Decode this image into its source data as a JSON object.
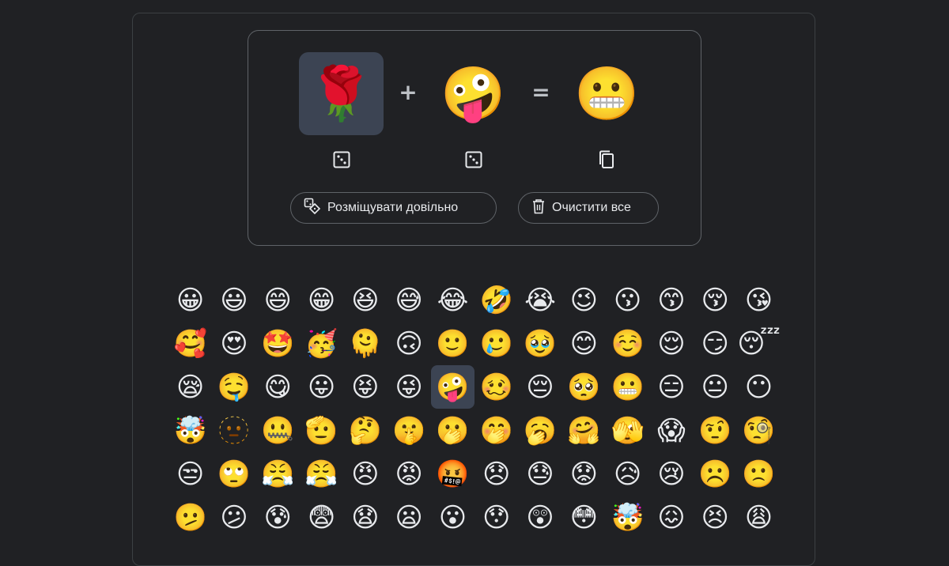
{
  "mixer": {
    "left_emoji": "🌹",
    "left_icon_name": "rose",
    "plus_sign": "+",
    "right_emoji": "🤪",
    "right_icon_name": "zany-face",
    "equals_sign": "=",
    "result_emoji": "😬",
    "result_icon_name": "grimacing-face-with-rose",
    "left_action_icon": "dice-icon",
    "right_action_icon": "dice-icon",
    "result_action_icon": "copy-icon"
  },
  "actions": {
    "randomize_label": "Розміщувати довільно",
    "clear_label": "Очистити все"
  },
  "colors": {
    "background": "#202124",
    "selected_slot": "#3c4453",
    "border": "#5f6368"
  },
  "grid": {
    "selected_index": 34,
    "emojis": [
      "😀",
      "😃",
      "😄",
      "😁",
      "😆",
      "😅",
      "😂",
      "🤣",
      "😭",
      "😉",
      "😗",
      "😙",
      "😚",
      "😘",
      "🥰",
      "😍",
      "🤩",
      "🥳",
      "🫠",
      "🙃",
      "🙂",
      "🥲",
      "🥹",
      "😊",
      "☺️",
      "😌",
      "😏",
      "😴",
      "😪",
      "🤤",
      "😋",
      "😛",
      "😝",
      "😜",
      "🤪",
      "🥴",
      "😔",
      "🥺",
      "😬",
      "😑",
      "😐",
      "😶",
      "🤯",
      "🫥",
      "🤐",
      "🫡",
      "🤔",
      "🤫",
      "🫢",
      "🤭",
      "🥱",
      "🤗",
      "🫣",
      "😱",
      "🤨",
      "🧐",
      "😒",
      "🙄",
      "😤",
      "😤",
      "😠",
      "😡",
      "🤬",
      "😞",
      "😓",
      "😟",
      "😥",
      "😢",
      "☹️",
      "🙁",
      "🫤",
      "😕",
      "😰",
      "😨",
      "😧",
      "😦",
      "😮",
      "😯",
      "😲",
      "😳",
      "🤯",
      "😖",
      "😣",
      "😩"
    ]
  }
}
